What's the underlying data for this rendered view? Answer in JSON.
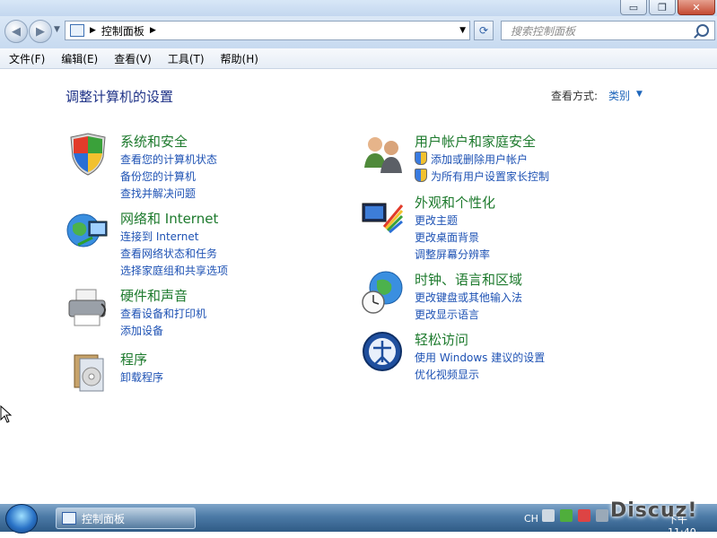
{
  "window": {
    "buttons": {
      "minimize": "▭",
      "restore": "❐",
      "close": "✕"
    }
  },
  "nav": {
    "back_icon": "◀",
    "forward_icon": "▶",
    "dropdown_icon": "▼",
    "address": {
      "icon": "control-panel-icon",
      "sep": "▶",
      "location": "控制面板",
      "sep2": "▶",
      "dropdown": "▼"
    },
    "refresh_icon": "⟳",
    "search_placeholder": "搜索控制面板"
  },
  "menu": [
    "文件(F)",
    "编辑(E)",
    "查看(V)",
    "工具(T)",
    "帮助(H)"
  ],
  "content": {
    "heading": "调整计算机的设置",
    "view_by_label": "查看方式:",
    "view_by_value": "类别",
    "view_by_arrow": "▼",
    "categories_left": [
      {
        "title": "系统和安全",
        "icon": "security-shield-icon",
        "links": [
          "查看您的计算机状态",
          "备份您的计算机",
          "查找并解决问题"
        ]
      },
      {
        "title": "网络和 Internet",
        "icon": "network-globe-icon",
        "links": [
          "连接到 Internet",
          "查看网络状态和任务",
          "选择家庭组和共享选项"
        ]
      },
      {
        "title": "硬件和声音",
        "icon": "printer-icon",
        "links": [
          "查看设备和打印机",
          "添加设备"
        ]
      },
      {
        "title": "程序",
        "icon": "programs-icon",
        "links": [
          "卸载程序"
        ]
      }
    ],
    "categories_right": [
      {
        "title": "用户帐户和家庭安全",
        "icon": "user-accounts-icon",
        "links": [
          "添加或删除用户帐户",
          "为所有用户设置家长控制"
        ]
      },
      {
        "title": "外观和个性化",
        "icon": "appearance-icon",
        "links": [
          "更改主题",
          "更改桌面背景",
          "调整屏幕分辨率"
        ]
      },
      {
        "title": "时钟、语言和区域",
        "icon": "clock-globe-icon",
        "links": [
          "更改键盘或其他输入法",
          "更改显示语言"
        ]
      },
      {
        "title": "轻松访问",
        "icon": "ease-of-access-icon",
        "links": [
          "使用 Windows 建议的设置",
          "优化视频显示"
        ]
      }
    ]
  },
  "taskbar": {
    "task_label": "控制面板",
    "lang": "CH",
    "clock": "下午 11:40"
  },
  "watermark": "Discuz!"
}
